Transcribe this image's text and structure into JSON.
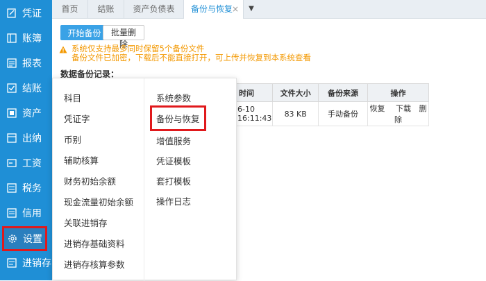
{
  "sidebar": {
    "items": [
      {
        "label": "凭证",
        "icon": "edit-icon"
      },
      {
        "label": "账簿",
        "icon": "book-icon"
      },
      {
        "label": "报表",
        "icon": "report-icon"
      },
      {
        "label": "结账",
        "icon": "checkbox-icon"
      },
      {
        "label": "资产",
        "icon": "asset-icon"
      },
      {
        "label": "出纳",
        "icon": "cashier-icon"
      },
      {
        "label": "工资",
        "icon": "salary-icon"
      },
      {
        "label": "税务",
        "icon": "tax-icon"
      },
      {
        "label": "信用",
        "icon": "credit-icon"
      },
      {
        "label": "设置",
        "icon": "gear-icon"
      },
      {
        "label": "进销存",
        "icon": "inventory-icon"
      }
    ]
  },
  "tabs": [
    {
      "label": "首页"
    },
    {
      "label": "结账"
    },
    {
      "label": "资产负债表"
    },
    {
      "label": "备份与恢复",
      "close": "×"
    }
  ],
  "tab_dropdown": "▼",
  "toolbar": {
    "start_backup": "开始备份",
    "batch_delete": "批量删除"
  },
  "warning": {
    "line1": "系统仅支持最多同时保留5个备份文件",
    "line2": "备份文件已加密，下载后不能直接打开，可上传并恢复到本系统查看"
  },
  "records_title": "数据备份记录：",
  "table": {
    "headers": [
      "时间",
      "文件大小",
      "备份来源",
      "操作"
    ],
    "row": {
      "time": "6-10 16:11:43",
      "size": "83 KB",
      "source": "手动备份",
      "restore": "恢复",
      "download": "下载",
      "delete": "删除"
    }
  },
  "menu": {
    "left": [
      "科目",
      "凭证字",
      "币别",
      "辅助核算",
      "财务初始余额",
      "现金流量初始余额",
      "关联进销存",
      "进销存基础资料",
      "进销存核算参数"
    ],
    "right": [
      "系统参数",
      "备份与恢复",
      "增值服务",
      "凭证模板",
      "套打模板",
      "操作日志"
    ]
  },
  "colors": {
    "sidebar": "#1f8fd6",
    "primary": "#3aa2e6",
    "highlight": "#e0191c",
    "warning": "#f39800"
  }
}
